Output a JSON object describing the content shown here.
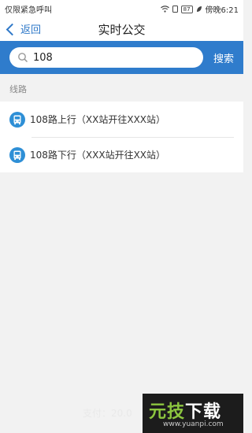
{
  "status_bar": {
    "carrier": "仅限紧急呼叫",
    "battery": "87",
    "time": "傍晚6:21"
  },
  "nav": {
    "back_label": "返回",
    "title": "实时公交"
  },
  "search": {
    "value": "108",
    "button_label": "搜索"
  },
  "section": {
    "label": "线路"
  },
  "routes": [
    {
      "label": "108路上行（XX站开往XXX站）"
    },
    {
      "label": "108路下行（XXX站开往XX站）"
    }
  ],
  "footer": {
    "text": "支付：20.0"
  },
  "watermark": {
    "brand_green": "元技",
    "brand_white": "下载",
    "url": "www.yuanpi.com"
  },
  "colors": {
    "accent": "#2f7ccc",
    "bus_icon": "#2e8fd6"
  }
}
